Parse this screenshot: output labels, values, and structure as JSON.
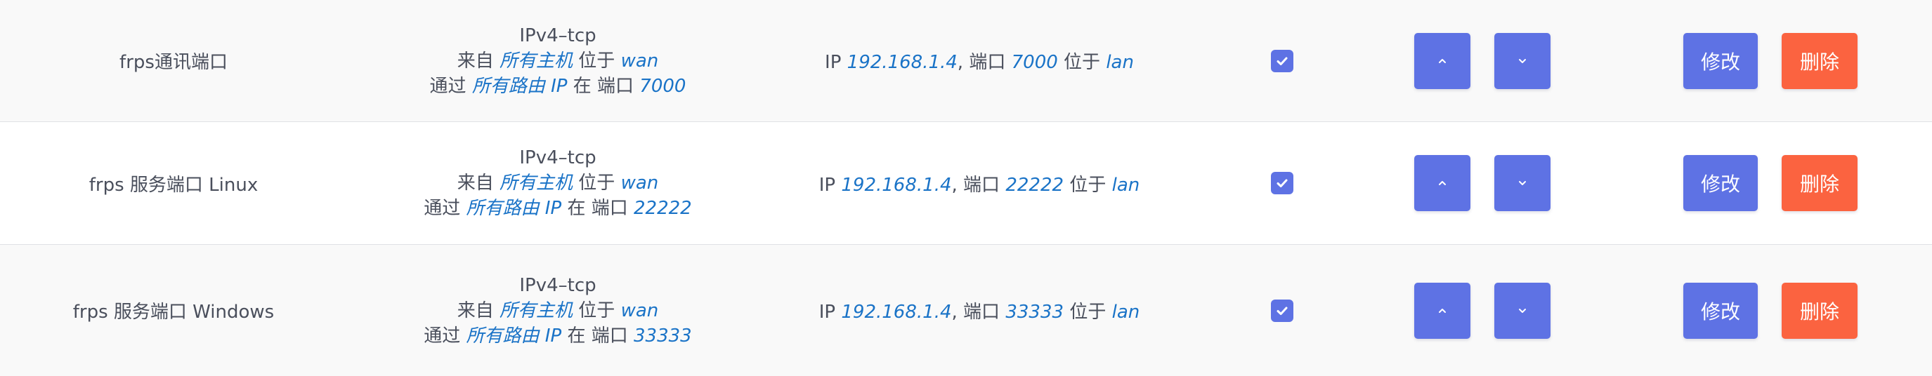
{
  "colors": {
    "primary": "#5e72e4",
    "danger": "#fb6340",
    "value_text": "#1a73c7",
    "row_alt_bg": "#f9f9f9"
  },
  "labels": {
    "from": "来自",
    "located_at": "位于",
    "via": "通过",
    "at": "在",
    "port": "端口",
    "ip": "IP",
    "comma": ","
  },
  "rows": [
    {
      "name": "frps通讯端口",
      "protocol": "IPv4–tcp",
      "src_hosts": "所有主机",
      "src_zone": "wan",
      "via_ip": "所有路由 IP",
      "ext_port": "7000",
      "dest_ip": "192.168.1.4",
      "dest_port": "7000",
      "dest_zone": "lan",
      "enabled": true,
      "up_icon": "chevron-up-icon",
      "down_icon": "chevron-down-icon",
      "edit_label": "修改",
      "delete_label": "删除"
    },
    {
      "name": "frps 服务端口 Linux",
      "protocol": "IPv4–tcp",
      "src_hosts": "所有主机",
      "src_zone": "wan",
      "via_ip": "所有路由 IP",
      "ext_port": "22222",
      "dest_ip": "192.168.1.4",
      "dest_port": "22222",
      "dest_zone": "lan",
      "enabled": true,
      "up_icon": "chevron-up-icon",
      "down_icon": "chevron-down-icon",
      "edit_label": "修改",
      "delete_label": "删除"
    },
    {
      "name": "frps 服务端口 Windows",
      "protocol": "IPv4–tcp",
      "src_hosts": "所有主机",
      "src_zone": "wan",
      "via_ip": "所有路由 IP",
      "ext_port": "33333",
      "dest_ip": "192.168.1.4",
      "dest_port": "33333",
      "dest_zone": "lan",
      "enabled": true,
      "up_icon": "chevron-up-icon",
      "down_icon": "chevron-down-icon",
      "edit_label": "修改",
      "delete_label": "删除"
    }
  ]
}
